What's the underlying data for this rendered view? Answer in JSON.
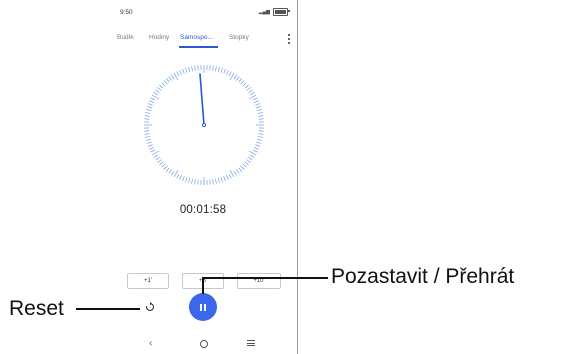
{
  "status": {
    "time": "9:50"
  },
  "tabs": [
    {
      "label": "Budík",
      "active": false
    },
    {
      "label": "Hodiny",
      "active": false
    },
    {
      "label": "Samospo...",
      "active": true
    },
    {
      "label": "Stopky",
      "active": false
    }
  ],
  "timer": {
    "display": "00:01:58",
    "add_buttons": [
      "+1'",
      "+5'",
      "+10'"
    ]
  },
  "controls": {
    "reset_icon": "reset-icon",
    "pause_icon": "pause-icon"
  },
  "annotations": {
    "reset": "Reset",
    "pause_play": "Pozastavit / Přehrát"
  },
  "colors": {
    "accent": "#3b67e8",
    "dial_ticks": "#6f9de6"
  }
}
